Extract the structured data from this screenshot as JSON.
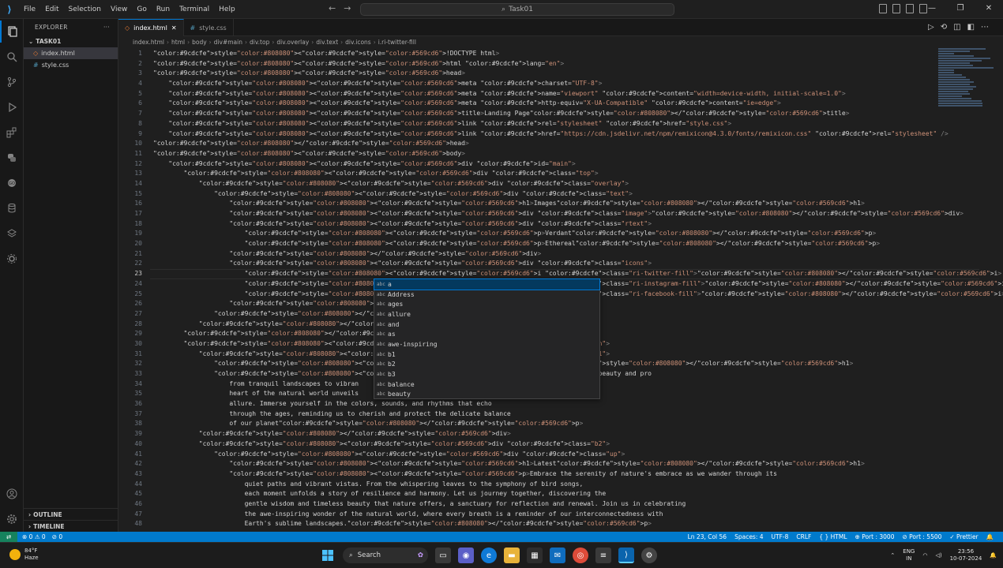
{
  "titlebar": {
    "menus": [
      "File",
      "Edit",
      "Selection",
      "View",
      "Go",
      "Run",
      "Terminal",
      "Help"
    ],
    "command_center": "Task01",
    "back_arrow": "←",
    "forward_arrow": "→",
    "window_controls": [
      "—",
      "❐",
      "✕"
    ]
  },
  "sidebar": {
    "title": "EXPLORER",
    "more": "···",
    "folder": "TASK01",
    "files": [
      {
        "name": "index.html",
        "type": "html",
        "selected": true
      },
      {
        "name": "style.css",
        "type": "css",
        "selected": false
      }
    ],
    "outline": "OUTLINE",
    "timeline": "TIMELINE"
  },
  "tabs": [
    {
      "label": "index.html",
      "type": "html",
      "active": true,
      "close": "✕"
    },
    {
      "label": "style.css",
      "type": "css",
      "active": false
    }
  ],
  "breadcrumb": [
    "index.html",
    "html",
    "body",
    "div#main",
    "div.top",
    "div.overlay",
    "div.text",
    "div.icons",
    "i.ri-twitter-fill"
  ],
  "editor": {
    "current_line": 23,
    "lines": [
      "<!DOCTYPE html>",
      "<html lang=\"en\">",
      "<head>",
      "    <meta charset=\"UTF-8\">",
      "    <meta name=\"viewport\" content=\"width=device-width, initial-scale=1.0\">",
      "    <meta http-equiv=\"X-UA-Compatible\" content=\"ie=edge\">",
      "    <title>Landing Page</title>",
      "    <link rel=\"stylesheet\" href=\"style.css\">",
      "    <link href=\"https://cdn.jsdelivr.net/npm/remixicon@4.3.0/fonts/remixicon.css\" rel=\"stylesheet\" />",
      "</head>",
      "<body>",
      "    <div id=\"main\">",
      "        <div class=\"top\">",
      "            <div class=\"overlay\">",
      "                <div class=\"text\">",
      "                    <h1>Images</h1>",
      "                    <div class=\"image\"></div>",
      "                    <div class=\"rtext\">",
      "                        <p>Verdant</p>",
      "                        <p>Ethereal</p>",
      "                    </div>",
      "                    <div class=\"icons\">",
      "                        <i class=\"ri-twitter-fill\"></i>",
      "                        <i class=\"ri-instagram-fill\"></i>",
      "                        <i class=\"ri-facebook-fill\"></i>",
      "                    </div>",
      "                </div>",
      "            </div>",
      "        </div>",
      "        <div class=\"button\">",
      "            <div class=\"b1\">",
      "                <h1>Popular</h1>",
      "                <p>Explore the boundless beauty and pro",
      "                    from tranquil landscapes to vibran",
      "                    heart of the natural world unveils",
      "                    allure. Immerse yourself in the colors, sounds, and rhythms that echo",
      "                    through the ages, reminding us to cherish and protect the delicate balance",
      "                    of our planet</p>",
      "            </div>",
      "            <div class=\"b2\">",
      "                <div class=\"up\">",
      "                    <h1>Latest</h1>",
      "                    <p>Embrace the serenity of nature's embrace as we wander through its",
      "                        quiet paths and vibrant vistas. From the whispering leaves to the symphony of bird songs,",
      "                        each moment unfolds a story of resilience and harmony. Let us journey together, discovering the",
      "                        gentle wisdom and timeless beauty that nature offers, a sanctuary for reflection and renewal. Join us in celebrating",
      "                        the awe-inspiring wonder of the natural world, where every breath is a reminder of our interconnectedness with",
      "                        Earth's sublime landscapes.</p>"
    ]
  },
  "suggestions": {
    "kind_label": "abc",
    "items": [
      "a",
      "Address",
      "ages",
      "allure",
      "and",
      "as",
      "awe-inspiring",
      "b1",
      "b2",
      "b3",
      "balance",
      "beauty"
    ],
    "selected_index": 0
  },
  "statusbar": {
    "remote": "⇄",
    "errors": "⊗ 0 ⚠ 0",
    "ports": "⊘ 0",
    "position": "Ln 23, Col 56",
    "spaces": "Spaces: 4",
    "encoding": "UTF-8",
    "eol": "CRLF",
    "language": "{ } HTML",
    "port_live": "⊕ Port : 3000",
    "port_5500": "⊘ Port : 5500",
    "prettier": "✓ Prettier",
    "bell": "🔔"
  },
  "taskbar": {
    "temperature": "84°F",
    "weather": "Haze",
    "search_label": "Search",
    "lang_top": "ENG",
    "lang_bottom": "IN",
    "time": "23:56",
    "date": "10-07-2024"
  },
  "colors": {
    "accent": "#007acc",
    "selection": "#04395e",
    "html_icon": "#e37933",
    "css_icon": "#519aba"
  }
}
